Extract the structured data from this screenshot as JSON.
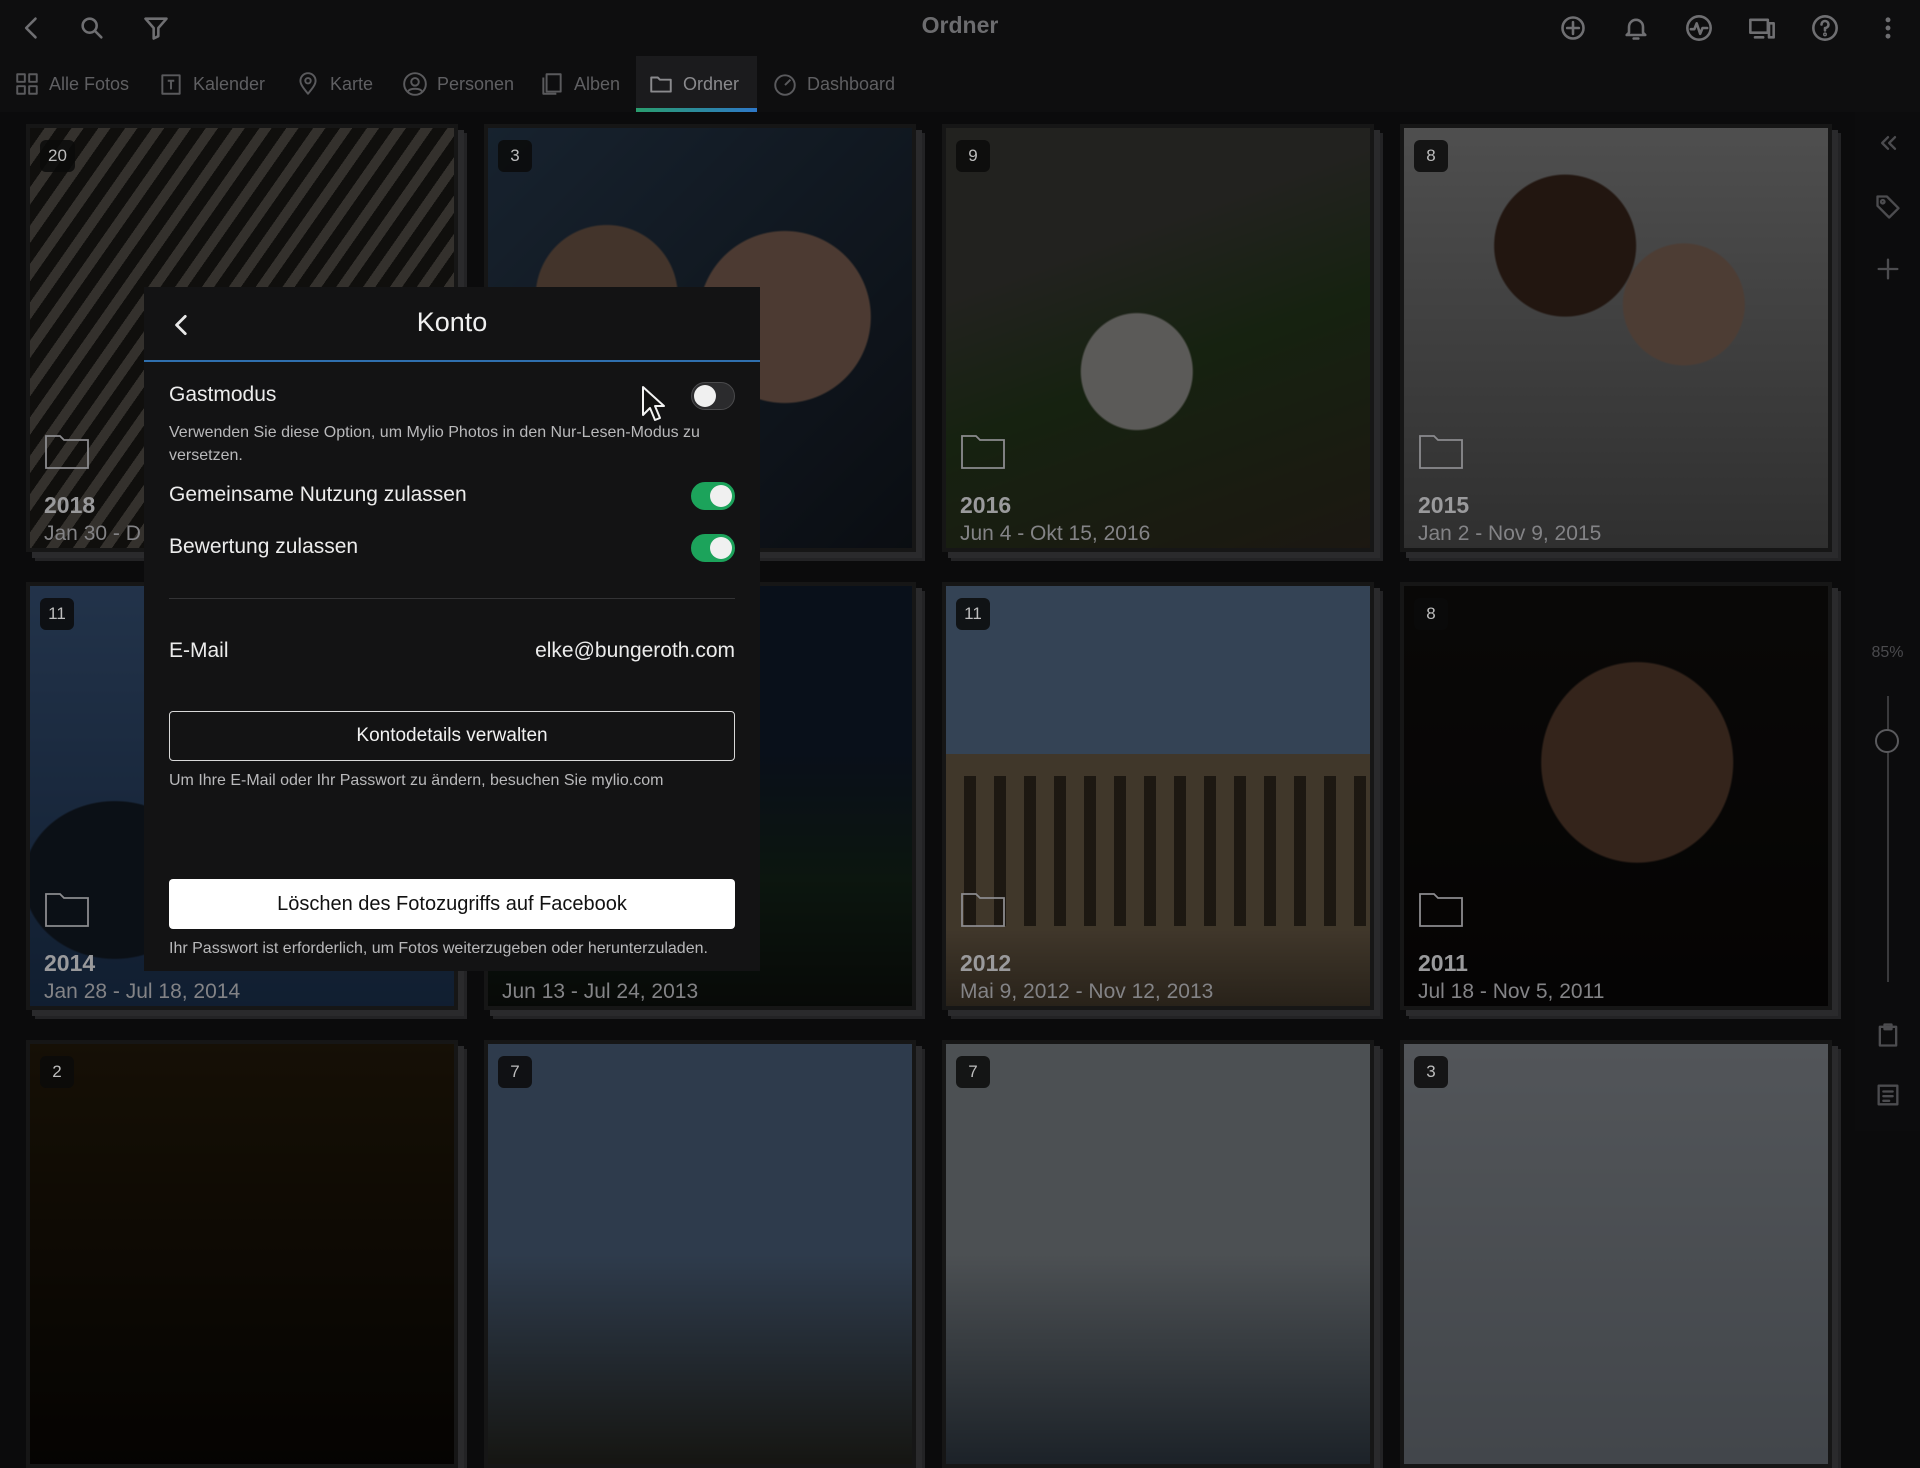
{
  "topbar": {
    "title": "Ordner",
    "icons": [
      "back-icon",
      "search-icon",
      "filter-icon",
      "add-circle-icon",
      "bell-icon",
      "activity-icon",
      "devices-icon",
      "help-icon",
      "more-vertical-icon"
    ]
  },
  "nav": {
    "tabs": [
      {
        "label": "Alle Fotos",
        "icon": "grid-icon"
      },
      {
        "label": "Kalender",
        "icon": "calendar-icon"
      },
      {
        "label": "Karte",
        "icon": "map-pin-icon"
      },
      {
        "label": "Personen",
        "icon": "person-icon"
      },
      {
        "label": "Alben",
        "icon": "album-icon"
      },
      {
        "label": "Ordner",
        "icon": "folder-icon",
        "active": true
      },
      {
        "label": "Dashboard",
        "icon": "dashboard-icon"
      }
    ]
  },
  "folders": [
    {
      "count": "20",
      "year": "2018",
      "range": "Jan 30 - D"
    },
    {
      "count": "3",
      "year": "",
      "range": ""
    },
    {
      "count": "9",
      "year": "2016",
      "range": "Jun 4 - Okt 15, 2016"
    },
    {
      "count": "8",
      "year": "2015",
      "range": "Jan 2 - Nov 9, 2015"
    },
    {
      "count": "11",
      "year": "2014",
      "range": "Jan 28 - Jul 18, 2014"
    },
    {
      "count": "",
      "year": "",
      "range": "Jun 13 - Jul 24, 2013"
    },
    {
      "count": "11",
      "year": "2012",
      "range": "Mai 9, 2012 - Nov 12, 2013"
    },
    {
      "count": "8",
      "year": "2011",
      "range": "Jul 18 - Nov 5, 2011"
    },
    {
      "count": "2",
      "year": "",
      "range": ""
    },
    {
      "count": "7",
      "year": "",
      "range": ""
    },
    {
      "count": "7",
      "year": "",
      "range": ""
    },
    {
      "count": "3",
      "year": "",
      "range": ""
    }
  ],
  "rail": {
    "zoom_label": "85%",
    "zoom_level": 0.85,
    "icons": [
      "collapse-icon",
      "tag-icon",
      "plus-icon",
      "clipboard-icon",
      "list-icon"
    ]
  },
  "modal": {
    "title": "Konto",
    "guest_mode": {
      "label": "Gastmodus",
      "on": false,
      "description": "Verwenden Sie diese Option, um Mylio Photos in den Nur-Lesen-Modus zu versetzen."
    },
    "sharing": {
      "label": "Gemeinsame Nutzung zulassen",
      "on": true
    },
    "rating": {
      "label": "Bewertung zulassen",
      "on": true
    },
    "email": {
      "label": "E-Mail",
      "value": "elke@bungeroth.com"
    },
    "manage_button": "Kontodetails verwalten",
    "manage_hint": "Um Ihre E-Mail oder Ihr Passwort zu ändern, besuchen Sie mylio.com",
    "facebook_button": "Löschen des Fotozugriffs auf Facebook",
    "facebook_hint": "Ihr Passwort ist erforderlich, um Fotos weiterzugeben oder herunterzuladen."
  },
  "colors": {
    "accent_green": "#1ca35b",
    "accent_blue": "#2f6fae",
    "background": "#0b0b0c"
  }
}
